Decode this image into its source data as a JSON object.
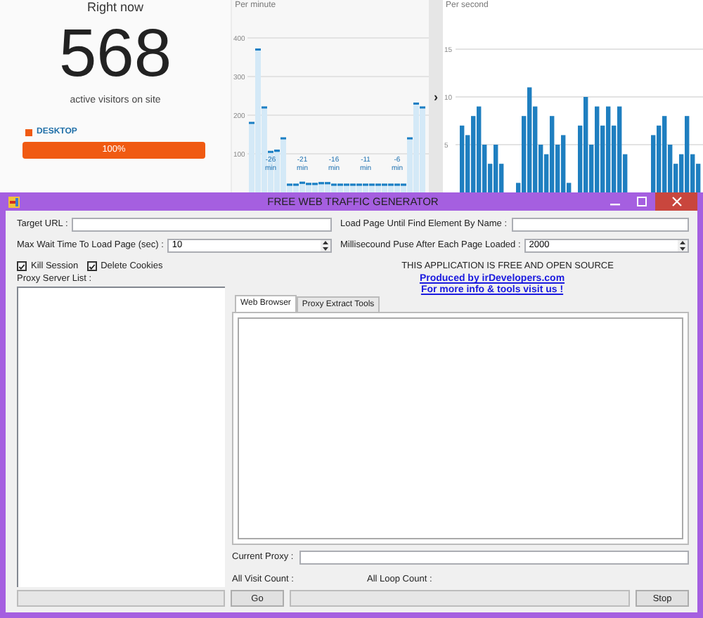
{
  "dashboard": {
    "title": "Right now",
    "active_count": "568",
    "active_caption": "active visitors on site",
    "device_label": "DESKTOP",
    "device_bar": {
      "level": 1,
      "reading": "100%"
    },
    "collapse_arrow": "›"
  },
  "per_minute": {
    "title": "Per minute",
    "chart_data": {
      "type": "bar",
      "categories": [
        null,
        null,
        null,
        "-26 min",
        null,
        null,
        null,
        null,
        "-21 min",
        null,
        null,
        null,
        null,
        "-16 min",
        null,
        null,
        null,
        null,
        "-11 min",
        null,
        null,
        null,
        null,
        "-6 min",
        null,
        null,
        null,
        null
      ],
      "values": [
        180,
        370,
        220,
        105,
        108,
        140,
        20,
        20,
        25,
        22,
        22,
        24,
        24,
        20,
        20,
        20,
        20,
        20,
        20,
        20,
        20,
        20,
        20,
        20,
        20,
        140,
        230,
        220
      ],
      "yticks": [
        100,
        200,
        300,
        400
      ],
      "ylim": [
        0,
        400
      ],
      "grid": true
    }
  },
  "per_second": {
    "title": "Per second",
    "chart_data": {
      "type": "bar",
      "values": [
        7,
        6,
        8,
        9,
        5,
        3,
        5,
        3,
        null,
        null,
        1,
        8,
        11,
        9,
        5,
        4,
        8,
        5,
        6,
        1,
        null,
        7,
        10,
        5,
        9,
        7,
        9,
        7,
        9,
        4,
        null,
        null,
        null,
        null,
        6,
        7,
        8,
        5,
        3,
        4,
        8,
        4,
        3
      ],
      "yticks": [
        5,
        10,
        15
      ],
      "ylim": [
        0,
        15
      ],
      "grid": true
    }
  },
  "window": {
    "title": "FREE WEB TRAFFIC GENERATOR",
    "target_url": {
      "label": "Target URL :"
    },
    "element_name": {
      "label": "Load Page Until Find Element By Name :"
    },
    "max_wait": {
      "label": "Max Wait Time To Load Page (sec) :",
      "value": "10"
    },
    "pause": {
      "label": "Millisecound Puse After Each Page Loaded :",
      "value": "2000"
    },
    "checkboxes": [
      {
        "label": "Kill Session",
        "checked": true
      },
      {
        "label": "Delete Cookies",
        "checked": true
      }
    ],
    "notice": "THIS APPLICATION IS FREE AND OPEN SOURCE",
    "links": [
      "Produced by irDevelopers.com",
      "For more info & tools visit us !"
    ],
    "proxy_list_label": "Proxy Server List :",
    "tabs": [
      {
        "label": "Web Browser",
        "selected": true
      },
      {
        "label": "Proxy Extract Tools",
        "selected": false
      }
    ],
    "current_proxy": {
      "label": "Current Proxy :"
    },
    "visit_count_label": "All Visit Count :",
    "loop_count_label": "All Loop Count :",
    "progress": [
      {
        "level": 0
      },
      {
        "level": 0
      }
    ],
    "buttons": [
      "Go",
      "Stop"
    ]
  }
}
